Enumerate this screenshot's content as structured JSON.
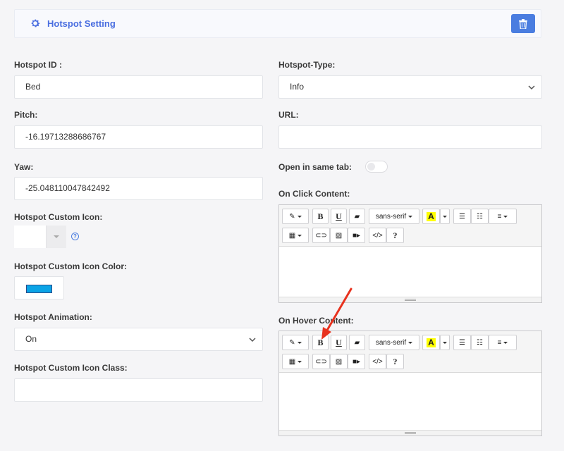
{
  "header": {
    "title": "Hotspot Setting",
    "gear_icon": "gear-icon",
    "delete_icon": "trash-icon",
    "accent": "#4a6ee0",
    "button_color": "#4a7de0"
  },
  "left": {
    "hotspot_id": {
      "label": "Hotspot ID :",
      "value": "Bed"
    },
    "pitch": {
      "label": "Pitch:",
      "value": "-16.19713288686767"
    },
    "yaw": {
      "label": "Yaw:",
      "value": "-25.048110047842492"
    },
    "custom_icon": {
      "label": "Hotspot Custom Icon:",
      "help_icon": "question-circle-icon",
      "help_glyph": "?"
    },
    "custom_icon_color": {
      "label": "Hotspot Custom Icon Color:",
      "color": "#0ba4e6"
    },
    "animation": {
      "label": "Hotspot Animation:",
      "value": "On"
    },
    "custom_icon_class": {
      "label": "Hotspot Custom Icon Class:",
      "value": ""
    }
  },
  "right": {
    "hotspot_type": {
      "label": "Hotspot-Type:",
      "value": "Info"
    },
    "url": {
      "label": "URL:",
      "value": ""
    },
    "same_tab": {
      "label": "Open in same tab:",
      "on": false
    },
    "on_click": {
      "label": "On Click Content:"
    },
    "on_hover": {
      "label": "On Hover Content:"
    }
  },
  "toolbar": {
    "bold": "B",
    "underline": "U",
    "font_name": "sans-serif",
    "color_letter": "A",
    "code": "</>",
    "help": "?",
    "icons": [
      "magic-icon",
      "eraser-icon",
      "unordered-list-icon",
      "ordered-list-icon",
      "align-icon",
      "table-icon",
      "link-icon",
      "picture-icon",
      "video-icon"
    ]
  }
}
